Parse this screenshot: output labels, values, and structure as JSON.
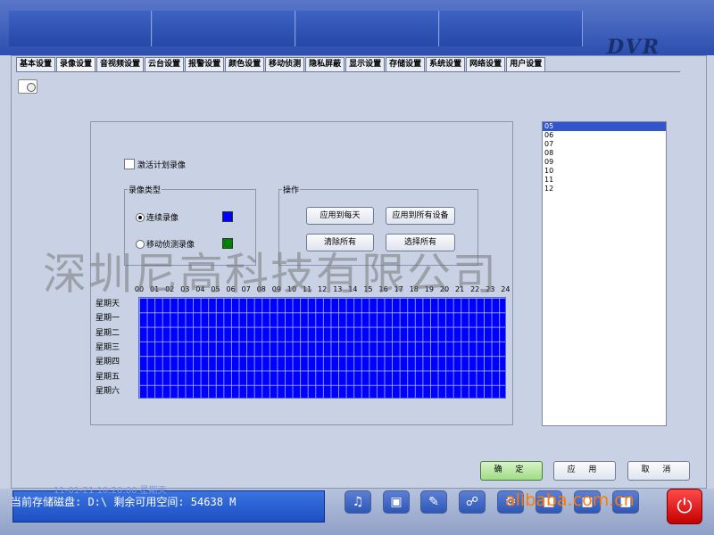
{
  "tabs": [
    "基本设置",
    "录像设置",
    "音视频设置",
    "云台设置",
    "报警设置",
    "颜色设置",
    "移动侦测",
    "隐私屏蔽",
    "显示设置",
    "存储设置",
    "系统设置",
    "网络设置",
    "用户设置"
  ],
  "logo": "DVR",
  "schedule": {
    "enable_label": "激活计划录像",
    "record_type": {
      "title": "录像类型",
      "continuous_label": "连续录像",
      "motion_label": "移动侦测录像",
      "continuous_color": "#0000ff",
      "motion_color": "#008000"
    },
    "operations": {
      "title": "操作",
      "apply_each_day": "应用到每天",
      "apply_all_devices": "应用到所有设备",
      "clear_all": "清除所有",
      "select_all": "选择所有"
    },
    "hours": [
      "00",
      "01",
      "02",
      "03",
      "04",
      "05",
      "06",
      "07",
      "08",
      "09",
      "10",
      "11",
      "12",
      "13",
      "14",
      "15",
      "16",
      "17",
      "18",
      "19",
      "20",
      "21",
      "22",
      "23",
      "24"
    ],
    "days": [
      "星期天",
      "星期一",
      "星期二",
      "星期三",
      "星期四",
      "星期五",
      "星期六"
    ],
    "grid_color": "#0000ff"
  },
  "device_list": [
    "05",
    "06",
    "07",
    "08",
    "09",
    "10",
    "11",
    "12"
  ],
  "buttons": {
    "ok": "确 定",
    "apply": "应 用",
    "cancel": "取 消"
  },
  "status": {
    "text": "当前存储磁盘: D:\\     剩余可用空间: 54638 M",
    "faded": "11-01-21    10:20:00        星期天"
  },
  "watermark": "深圳尼高科技有限公司",
  "site": "alibaba.com.cn"
}
